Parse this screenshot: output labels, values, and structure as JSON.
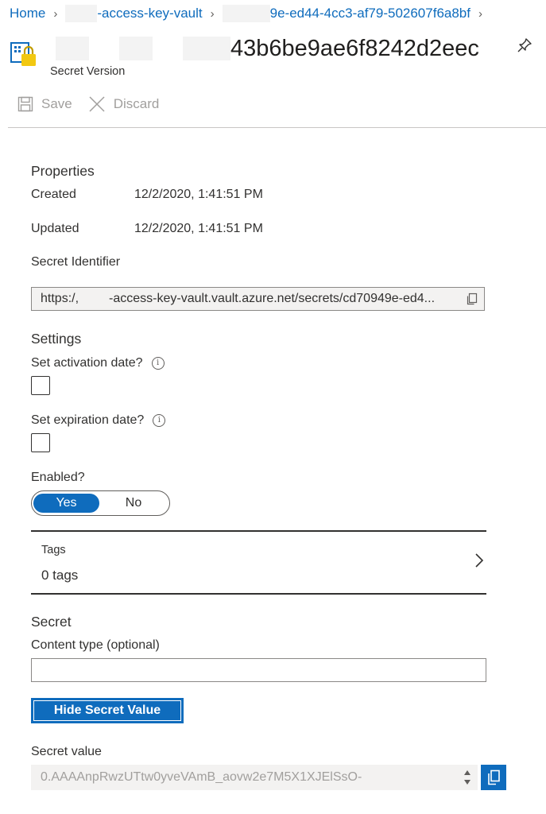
{
  "breadcrumb": {
    "home": "Home",
    "vault": "-access-key-vault",
    "secret": "9e-ed44-4cc3-af79-502607f6a8bf"
  },
  "header": {
    "title": "43b6be9ae6f8242d2eec",
    "subtitle": "Secret Version"
  },
  "toolbar": {
    "save_label": "Save",
    "discard_label": "Discard"
  },
  "properties": {
    "heading": "Properties",
    "created_label": "Created",
    "created_value": "12/2/2020, 1:41:51 PM",
    "updated_label": "Updated",
    "updated_value": "12/2/2020, 1:41:51 PM",
    "identifier_label": "Secret Identifier",
    "identifier_prefix": "https:/,",
    "identifier_value": "-access-key-vault.vault.azure.net/secrets/cd70949e-ed4..."
  },
  "settings": {
    "heading": "Settings",
    "activation_label": "Set activation date?",
    "expiration_label": "Set expiration date?",
    "enabled_label": "Enabled?",
    "yes_label": "Yes",
    "no_label": "No",
    "enabled": true
  },
  "tags": {
    "label": "Tags",
    "count": "0 tags"
  },
  "secret": {
    "heading": "Secret",
    "content_type_label": "Content type (optional)",
    "content_type_value": "",
    "hide_button_label": "Hide Secret Value",
    "value_label": "Secret value",
    "value": "0.AAAAnpRwzUTtw0yveVAmB_aovw2e7M5X1XJElSsO-"
  },
  "colors": {
    "accent": "#0f6cbd",
    "text": "#323130",
    "disabled": "#a19f9d",
    "field_bg": "#f3f2f1",
    "key_yellow": "#f2c811"
  }
}
